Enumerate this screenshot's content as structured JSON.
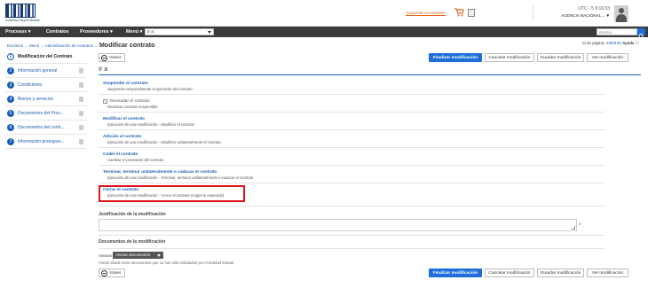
{
  "header": {
    "logo_text": "Colombia Compra Eficiente",
    "top_link": "Aumentar el contraste",
    "utc": "UTC - 5 9:16:33",
    "agency": "AGENCIA NACIONAL..."
  },
  "nav": {
    "items": [
      "Procesos",
      "Contratos",
      "Proveedores",
      "Menú"
    ],
    "goto_label": "Ir a",
    "search_placeholder": "Buscar..."
  },
  "breadcrumb": {
    "items": [
      "Escritorio",
      "Menú",
      "Administración de contratos"
    ],
    "current": "Modificar contrato",
    "separator": "→"
  },
  "page_id": {
    "label": "Id de página:",
    "value": "2300100",
    "help": "Ayuda"
  },
  "steps": [
    {
      "n": "1",
      "label": "Modificación del Contrato",
      "active": true,
      "locked": false
    },
    {
      "n": "2",
      "label": "Información general",
      "active": false,
      "locked": true
    },
    {
      "n": "3",
      "label": "Condiciones",
      "active": false,
      "locked": true
    },
    {
      "n": "4",
      "label": "Bienes y servicios",
      "active": false,
      "locked": true
    },
    {
      "n": "5",
      "label": "Documentos del Prov...",
      "active": false,
      "locked": true
    },
    {
      "n": "6",
      "label": "Documentos del contr...",
      "active": false,
      "locked": true
    },
    {
      "n": "7",
      "label": "Información presupue...",
      "active": false,
      "locked": true
    }
  ],
  "actions": {
    "back": "Volver",
    "finish": "Finalizar modificación",
    "cancel": "Cancelar modificación",
    "save": "Guardar modificación",
    "view": "Ver modificación"
  },
  "section_title": "Ir a",
  "options": [
    {
      "title": "Suspender el contrato",
      "desc": "Suspender temporalmente la ejecución del contrato"
    },
    {
      "title": "Reanudar el contrato",
      "desc": "Reactivar contrato suspendido"
    },
    {
      "title": "Modificar el contrato",
      "desc": "Ejecución de una modificación - Modificar el contrato"
    },
    {
      "title": "Adición al contrato",
      "desc": "Ejecución de una modificación - Modificar unilateralmente el contrato"
    },
    {
      "title": "Ceder el contrato",
      "desc": "Cambiar el proveedor del contrato"
    },
    {
      "title": "Terminar, terminar unilateralmente o caducar el contrato",
      "desc": "Ejecución de una modificación - Terminar, terminar unilateralmente o caducar el contrato"
    },
    {
      "title": "Cerrar el contrato",
      "desc": "Ejecución de una modificación - Cerrar el contrato (según lo esperado)"
    }
  ],
  "justification": {
    "label": "Justificación de la modificación",
    "value": "",
    "required_mark": "*"
  },
  "documents": {
    "label": "Documentos de la modificación",
    "anexo_label": "Anexos",
    "anexo_button": "Anexar documentos",
    "note": "Puede añadir otros documentos que no han sido solicitados por el Entidad Estatal"
  }
}
